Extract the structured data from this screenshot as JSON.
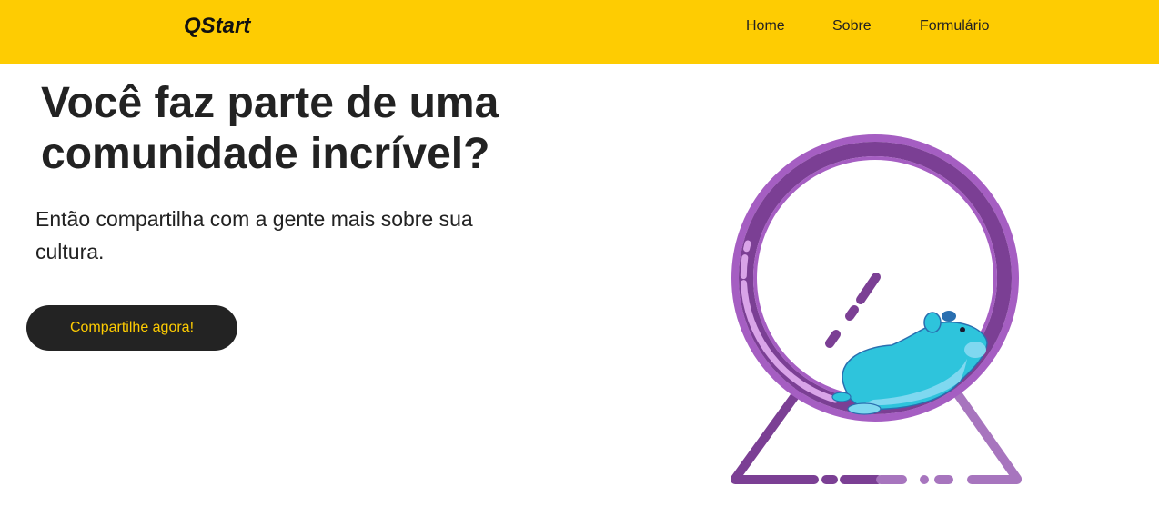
{
  "header": {
    "brand": "QStart",
    "nav": [
      {
        "label": "Home"
      },
      {
        "label": "Sobre"
      },
      {
        "label": "Formulário"
      }
    ]
  },
  "hero": {
    "title": "Você faz parte de uma comunidade incrível?",
    "subtitle": "Então compartilha com a gente mais sobre sua cultura.",
    "cta_label": "Compartilhe agora!"
  },
  "illustration": {
    "icon": "hamster-wheel-illustration"
  },
  "colors": {
    "accent": "#fecc02",
    "button_bg": "#232323",
    "text": "#222222",
    "wheel_purple": "#7b3f94",
    "hamster_blue": "#2ec4dc"
  }
}
